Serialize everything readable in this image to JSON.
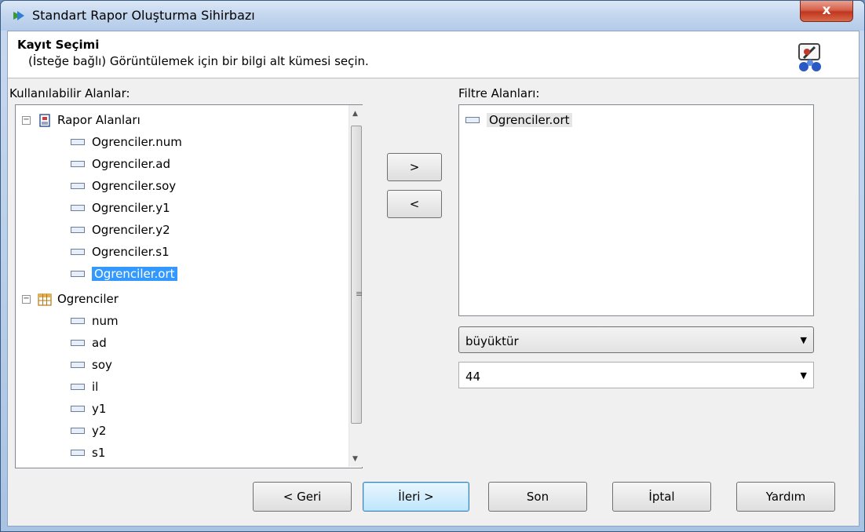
{
  "window": {
    "title": "Standart Rapor Oluşturma Sihirbazı",
    "close_label": "x"
  },
  "header": {
    "title": "Kayıt Seçimi",
    "subtitle": "(İsteğe bağlı) Görüntülemek için bir bilgi alt kümesi seçin."
  },
  "available": {
    "label": "Kullanılabilir Alanlar:",
    "groups": [
      {
        "name": "Rapor Alanları",
        "fields": [
          "Ogrenciler.num",
          "Ogrenciler.ad",
          "Ogrenciler.soy",
          "Ogrenciler.y1",
          "Ogrenciler.y2",
          "Ogrenciler.s1",
          "Ogrenciler.ort"
        ]
      },
      {
        "name": "Ogrenciler",
        "fields": [
          "num",
          "ad",
          "soy",
          "il",
          "y1",
          "y2",
          "s1"
        ]
      }
    ],
    "selected": "Ogrenciler.ort"
  },
  "move": {
    "add_label": ">",
    "remove_label": "<"
  },
  "filter": {
    "label": "Filtre Alanları:",
    "items": [
      "Ogrenciler.ort"
    ],
    "operator": "büyüktür",
    "value": "44"
  },
  "footer": {
    "back": "< Geri",
    "next": "İleri >",
    "finish": "Son",
    "cancel": "İptal",
    "help": "Yardım"
  }
}
